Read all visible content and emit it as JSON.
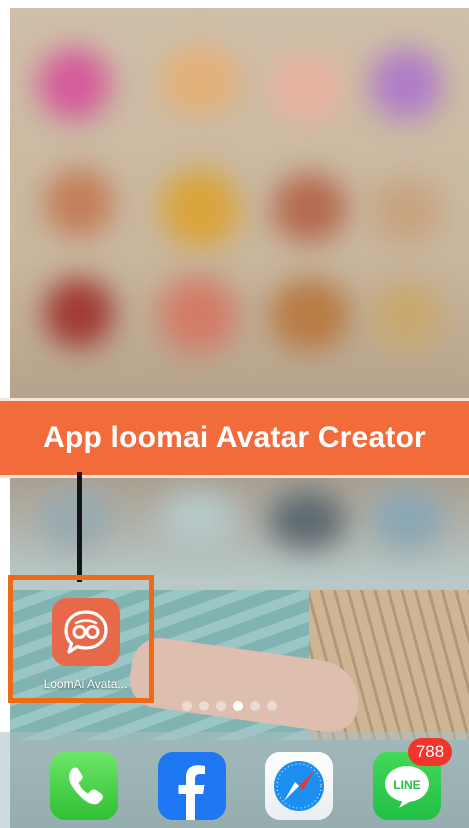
{
  "banner": {
    "title": "App loomai Avatar Creator"
  },
  "home_screen": {
    "highlighted_app": {
      "label": "LoomAi Avata...",
      "icon": "loomai-chat-bubble-icon"
    },
    "page_dots": {
      "count": 6,
      "active_index": 3
    }
  },
  "dock": {
    "apps": [
      {
        "name": "Phone",
        "icon": "phone-icon"
      },
      {
        "name": "Facebook",
        "icon": "facebook-icon"
      },
      {
        "name": "Safari",
        "icon": "compass-icon"
      },
      {
        "name": "LINE",
        "icon": "line-icon",
        "badge": "788",
        "glyph_text": "LINE"
      }
    ]
  },
  "colors": {
    "banner": "#f26c3b",
    "highlight_border": "#ef6a17",
    "app_icon": "#e8694a"
  }
}
